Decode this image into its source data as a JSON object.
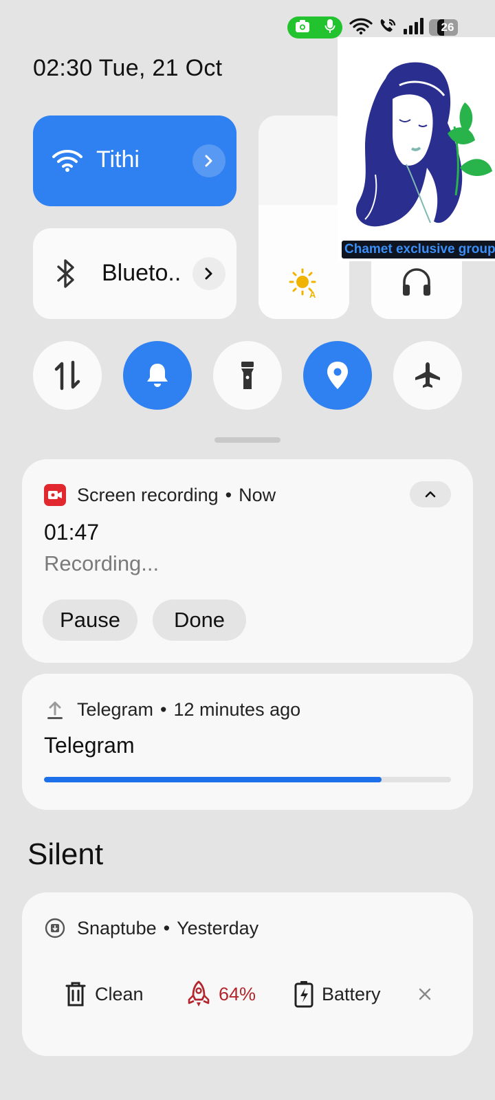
{
  "status_bar": {
    "battery_level": "26",
    "indicators": [
      "camera-icon",
      "mic-icon",
      "wifi-icon",
      "wifi-calling-icon",
      "signal-icon",
      "battery-icon"
    ]
  },
  "header": {
    "datetime": "02:30  Tue, 21 Oct"
  },
  "quick_tiles": {
    "wifi": {
      "label": "Tithi",
      "active": true
    },
    "bluetooth": {
      "label": "Blueto..",
      "active": false
    },
    "brightness": {
      "icon": "auto-brightness-icon"
    },
    "volume": {
      "icon": "headphones-icon"
    }
  },
  "toggles": [
    {
      "name": "mobile-data",
      "active": false
    },
    {
      "name": "sound",
      "active": true
    },
    {
      "name": "flashlight",
      "active": false
    },
    {
      "name": "location",
      "active": true
    },
    {
      "name": "airplane-mode",
      "active": false
    }
  ],
  "notifications": {
    "screen_recording": {
      "app": "Screen recording",
      "time": "Now",
      "timer": "01:47",
      "status": "Recording...",
      "pause_label": "Pause",
      "done_label": "Done"
    },
    "telegram": {
      "app": "Telegram",
      "time": "12 minutes ago",
      "title": "Telegram",
      "progress": 0.83
    }
  },
  "silent_section": {
    "heading": "Silent",
    "snaptube": {
      "app": "Snaptube",
      "time": "Yesterday",
      "clean_label": "Clean",
      "boost_label": "64%",
      "battery_label": "Battery"
    }
  },
  "overlay": {
    "label": "Chamet exclusive group"
  },
  "colors": {
    "accent": "#2f80f0",
    "record_red": "#e0282e",
    "boost_red": "#b3262d",
    "green_pill": "#22c32e",
    "progress": "#1e6fea"
  }
}
